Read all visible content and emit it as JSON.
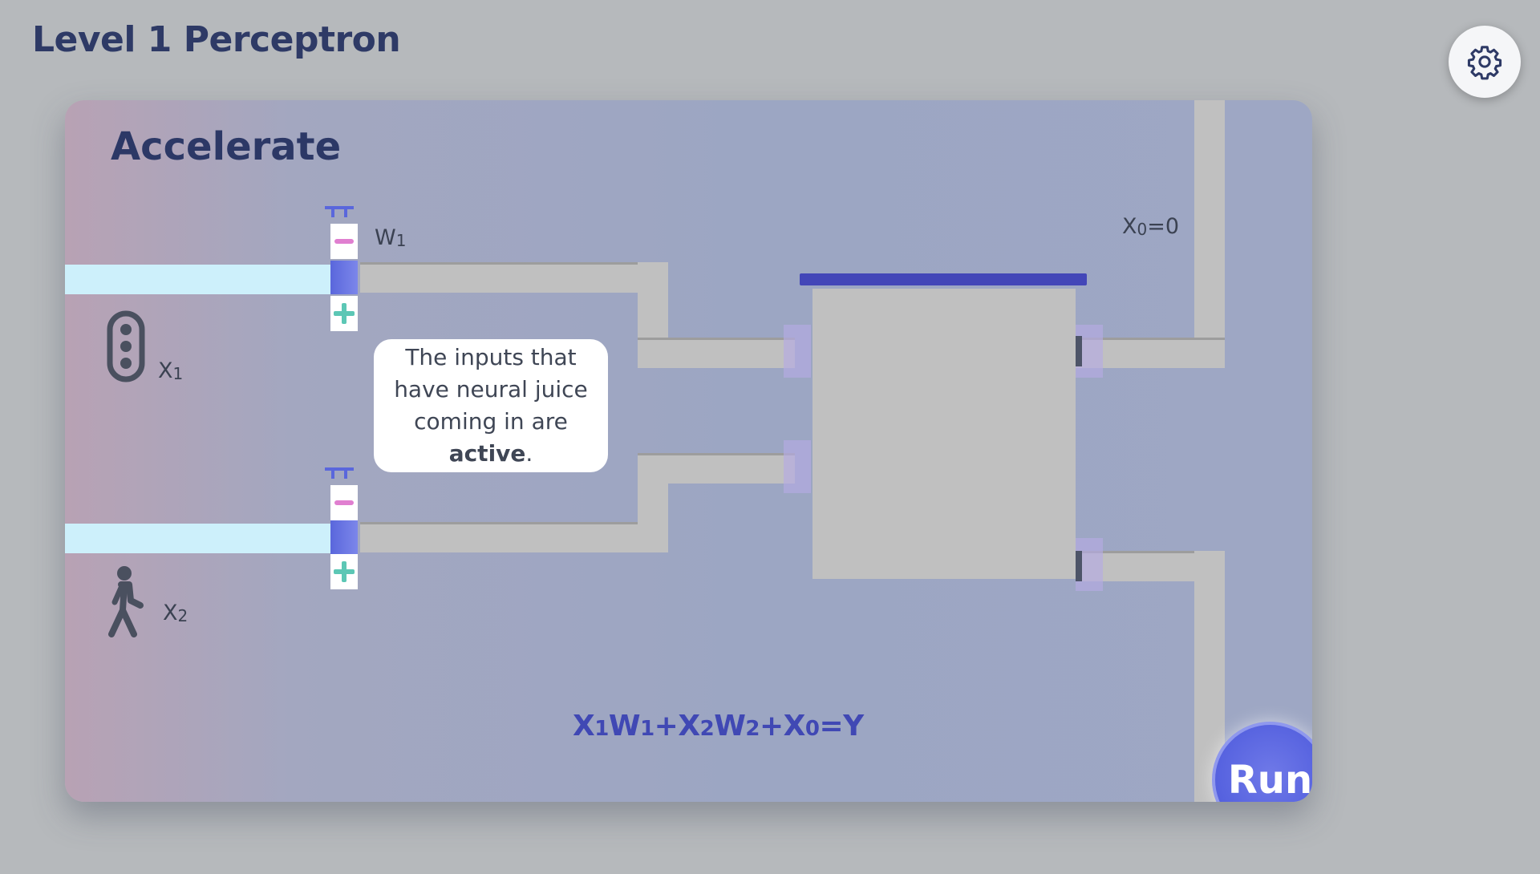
{
  "header": {
    "title": "Level 1 Perceptron",
    "settings_icon": "gear-icon"
  },
  "level": {
    "name": "Accelerate"
  },
  "inputs": [
    {
      "label": "X",
      "subscript": "1",
      "icon": "traffic-light-icon",
      "active": true
    },
    {
      "label": "X",
      "subscript": "2",
      "icon": "walking-person-icon",
      "active": true
    }
  ],
  "weights": [
    {
      "label": "W",
      "subscript": "1",
      "minus_icon": "minus-icon",
      "plus_icon": "plus-icon"
    },
    {
      "label": "",
      "subscript": "",
      "minus_icon": "minus-icon",
      "plus_icon": "plus-icon"
    }
  ],
  "bias": {
    "label": "X",
    "subscript": "0",
    "value_text": "=0"
  },
  "tooltip": {
    "text_before": "The inputs that have neural juice coming in are ",
    "text_bold": "active",
    "text_after": "."
  },
  "formula": {
    "parts": [
      "X",
      "1",
      "W",
      "1",
      "+X",
      "2",
      "W",
      "2",
      "+X",
      "0",
      "=Y"
    ]
  },
  "run_button": {
    "label": "Run"
  },
  "colors": {
    "background": "#b6b9bc",
    "title": "#2e3a66",
    "juice": "#cdf0fb",
    "pipe": "#c0c0c0",
    "accent": "#5864e0",
    "formula": "#4048b4"
  }
}
